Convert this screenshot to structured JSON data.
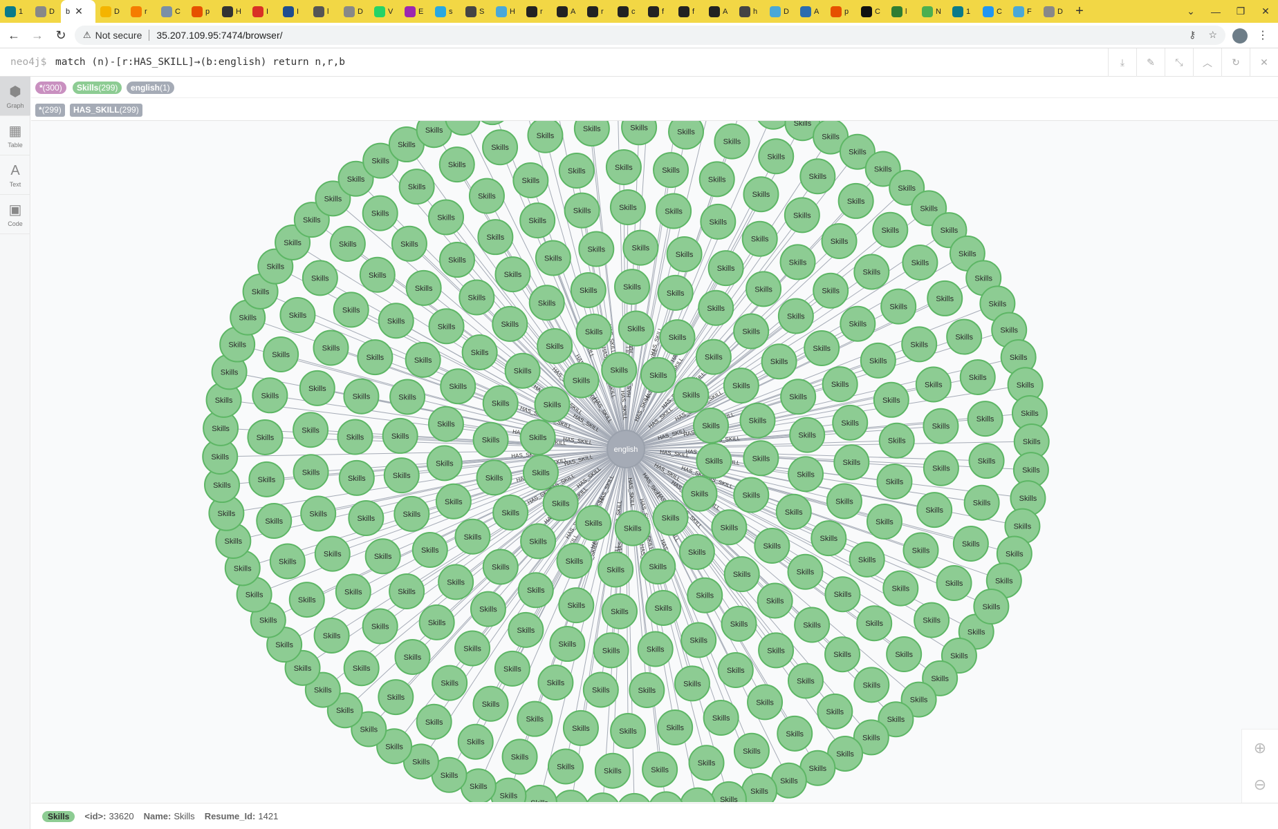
{
  "browser": {
    "tabs": [
      {
        "title": "1",
        "color": "#0a7a8a"
      },
      {
        "title": "D",
        "color": "#888"
      },
      {
        "title": "b",
        "color": "#ffffff",
        "active": true
      },
      {
        "title": "D",
        "color": "#f4b400"
      },
      {
        "title": "r",
        "color": "#f57c00"
      },
      {
        "title": "C",
        "color": "#7a8fa6"
      },
      {
        "title": "p",
        "color": "#e65100"
      },
      {
        "title": "H",
        "color": "#333"
      },
      {
        "title": "I",
        "color": "#d93025"
      },
      {
        "title": "I",
        "color": "#1e4d8f"
      },
      {
        "title": "l",
        "color": "#555"
      },
      {
        "title": "D",
        "color": "#888"
      },
      {
        "title": "V",
        "color": "#25d366"
      },
      {
        "title": "E",
        "color": "#9c27b0"
      },
      {
        "title": "s",
        "color": "#29a8e0"
      },
      {
        "title": "S",
        "color": "#444"
      },
      {
        "title": "H",
        "color": "#4aa8d8"
      },
      {
        "title": "r",
        "color": "#222"
      },
      {
        "title": "A",
        "color": "#222"
      },
      {
        "title": "r",
        "color": "#222"
      },
      {
        "title": "c",
        "color": "#222"
      },
      {
        "title": "f",
        "color": "#222"
      },
      {
        "title": "f",
        "color": "#222"
      },
      {
        "title": "A",
        "color": "#222"
      },
      {
        "title": "h",
        "color": "#444"
      },
      {
        "title": "D",
        "color": "#4aa8d8"
      },
      {
        "title": "A",
        "color": "#2b6cb0"
      },
      {
        "title": "p",
        "color": "#e65100"
      },
      {
        "title": "C",
        "color": "#111"
      },
      {
        "title": "l",
        "color": "#2e7d32"
      },
      {
        "title": "N",
        "color": "#4caf50"
      },
      {
        "title": "1",
        "color": "#0a7a8a"
      },
      {
        "title": "C",
        "color": "#2196f3"
      },
      {
        "title": "F",
        "color": "#4aa8d8"
      },
      {
        "title": "D",
        "color": "#888"
      }
    ],
    "new_tab": "+",
    "url_warning": "Not secure",
    "url": "35.207.109.95:7474/browser/"
  },
  "editor": {
    "prompt": "neo4j$",
    "query": "match (n)-[r:HAS_SKILL]→(b:english) return n,r,b"
  },
  "sidebar": {
    "items": [
      {
        "label": "Graph",
        "icon": "graph-icon",
        "active": true
      },
      {
        "label": "Table",
        "icon": "table-icon"
      },
      {
        "label": "Text",
        "icon": "text-icon"
      },
      {
        "label": "Code",
        "icon": "code-icon"
      }
    ]
  },
  "legend": {
    "node_labels": [
      {
        "name": "*",
        "count": "(300)",
        "color": "#c990c0"
      },
      {
        "name": "Skills",
        "count": "(299)",
        "color": "#8dcc93"
      },
      {
        "name": "english",
        "count": "(1)",
        "color": "#a5abb6"
      }
    ],
    "rel_types": [
      {
        "name": "*",
        "count": "(299)"
      },
      {
        "name": "HAS_SKILL",
        "count": "(299)"
      }
    ]
  },
  "graph": {
    "center_label": "english",
    "node_label": "Skills",
    "edge_label": "HAS_SKILL",
    "node_count": 299,
    "node_color": "#8dcc93",
    "node_border": "#5db665",
    "center_color": "#a5abb6",
    "center_border": "#9aa1ac"
  },
  "status": {
    "pill": "Skills",
    "id_key": "<id>:",
    "id_val": "33620",
    "name_key": "Name:",
    "name_val": "Skills",
    "resume_key": "Resume_Id:",
    "resume_val": "1421"
  }
}
